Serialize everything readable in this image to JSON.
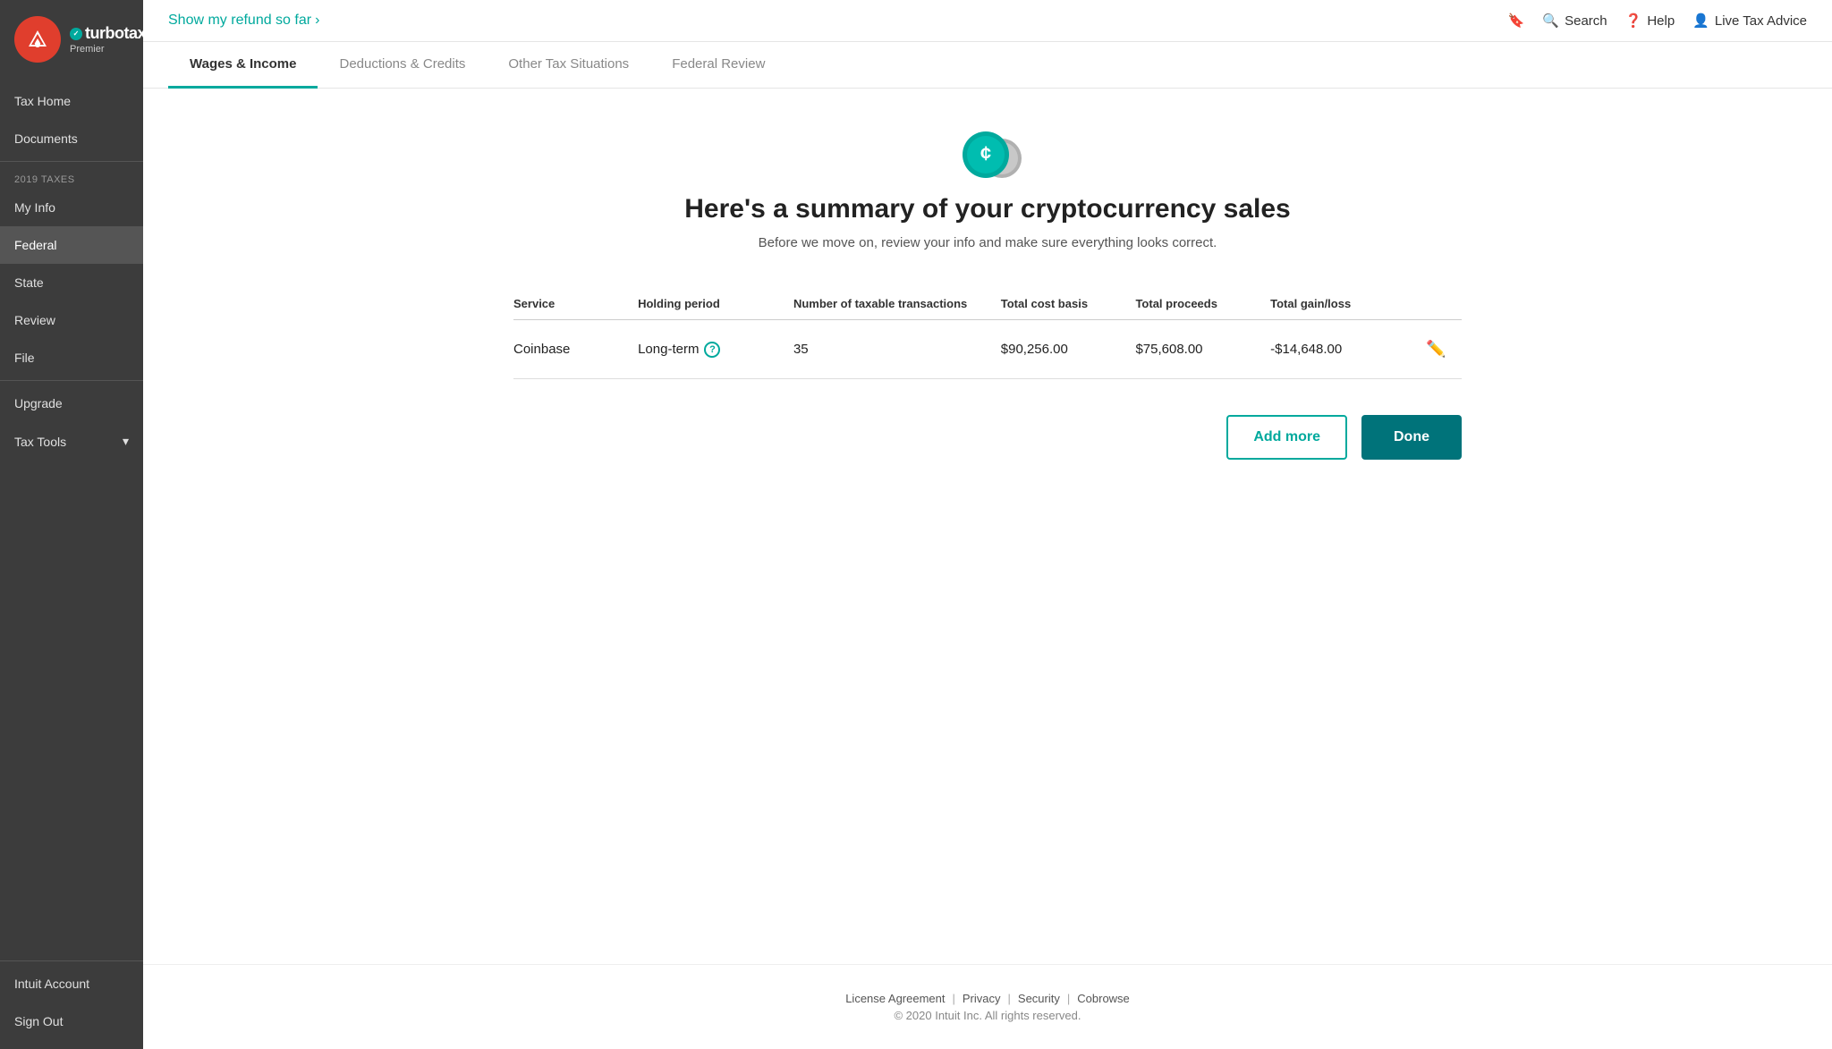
{
  "sidebar": {
    "logo": {
      "brand_name": "turbotax",
      "tier": "Premier"
    },
    "nav": [
      {
        "label": "Tax Home",
        "id": "tax-home",
        "active": false
      },
      {
        "label": "Documents",
        "id": "documents",
        "active": false
      }
    ],
    "section_label": "2019 TAXES",
    "tax_items": [
      {
        "label": "My Info",
        "id": "my-info",
        "active": false
      },
      {
        "label": "Federal",
        "id": "federal",
        "active": true
      },
      {
        "label": "State",
        "id": "state",
        "active": false
      },
      {
        "label": "Review",
        "id": "review",
        "active": false
      },
      {
        "label": "File",
        "id": "file",
        "active": false
      }
    ],
    "tools": [
      {
        "label": "Upgrade",
        "id": "upgrade"
      },
      {
        "label": "Tax Tools",
        "id": "tax-tools",
        "has_arrow": true
      }
    ],
    "bottom": [
      {
        "label": "Intuit Account",
        "id": "intuit-account"
      },
      {
        "label": "Sign Out",
        "id": "sign-out"
      }
    ]
  },
  "topbar": {
    "refund_link": "Show my refund so far",
    "actions": {
      "search": "Search",
      "help": "Help",
      "live_tax": "Live Tax Advice"
    }
  },
  "tabs": [
    {
      "label": "Wages & Income",
      "active": true
    },
    {
      "label": "Deductions & Credits",
      "active": false
    },
    {
      "label": "Other Tax Situations",
      "active": false
    },
    {
      "label": "Federal Review",
      "active": false
    }
  ],
  "content": {
    "title": "Here's a summary of your cryptocurrency sales",
    "subtitle": "Before we move on, review your info and make sure everything looks correct.",
    "table": {
      "headers": [
        "Service",
        "Holding period",
        "Number of taxable transactions",
        "Total cost basis",
        "Total proceeds",
        "Total gain/loss"
      ],
      "rows": [
        {
          "service": "Coinbase",
          "holding_period": "Long-term",
          "transactions": "35",
          "cost_basis": "$90,256.00",
          "proceeds": "$75,608.00",
          "gain_loss": "-$14,648.00"
        }
      ]
    },
    "add_more_label": "Add more",
    "done_label": "Done"
  },
  "footer": {
    "links": [
      "License Agreement",
      "Privacy",
      "Security",
      "Cobrowse"
    ],
    "copyright": "© 2020 Intuit Inc. All rights reserved."
  }
}
